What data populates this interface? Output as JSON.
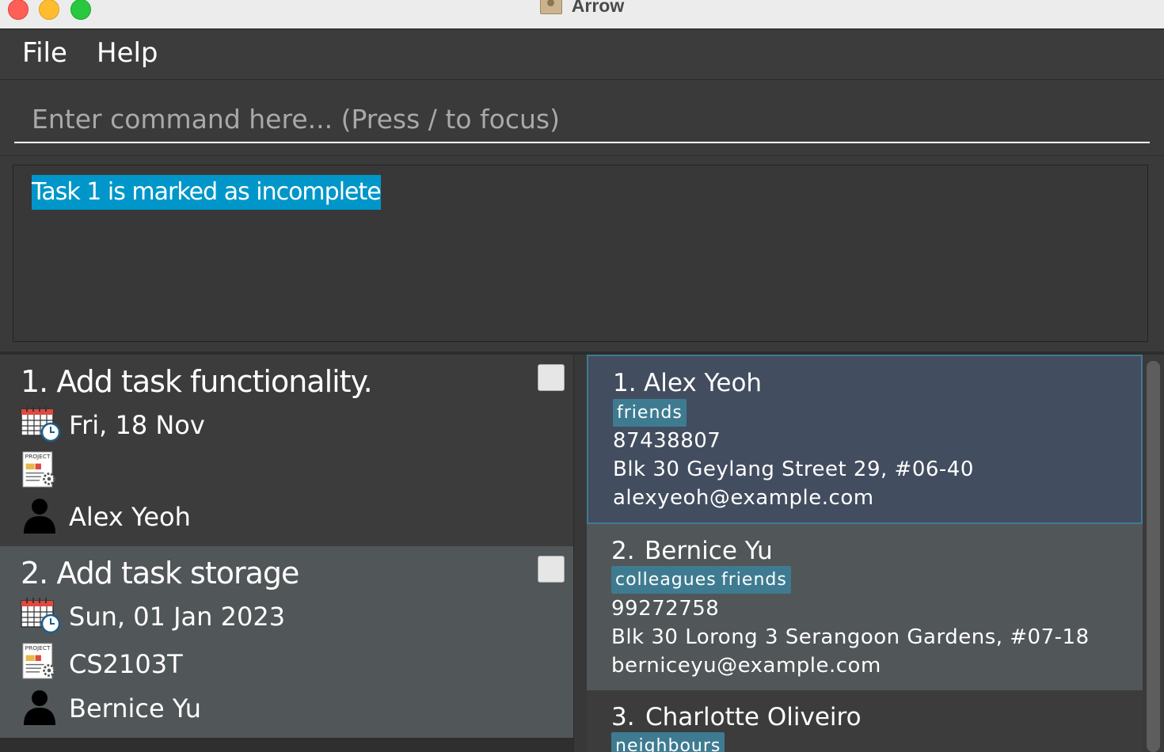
{
  "window": {
    "title": "Arrow"
  },
  "menu": {
    "file": "File",
    "help": "Help"
  },
  "command": {
    "placeholder": "Enter command here... (Press / to focus)"
  },
  "result": {
    "text": "Task 1 is marked as incomplete"
  },
  "tasks": [
    {
      "title": "1. Add task functionality.",
      "date": "Fri, 18 Nov",
      "project": "",
      "assignee": "Alex Yeoh",
      "completed": false
    },
    {
      "title": "2. Add task storage",
      "date": "Sun, 01 Jan 2023",
      "project": "CS2103T",
      "assignee": "Bernice Yu",
      "completed": false
    }
  ],
  "persons": [
    {
      "index": "1.",
      "name": "Alex Yeoh",
      "tags": [
        "friends"
      ],
      "phone": "87438807",
      "address": "Blk 30 Geylang Street 29, #06-40",
      "email": "alexyeoh@example.com"
    },
    {
      "index": "2.",
      "name": "Bernice Yu",
      "tags": [
        "colleagues",
        "friends"
      ],
      "phone": "99272758",
      "address": "Blk 30 Lorong 3 Serangoon Gardens, #07-18",
      "email": "berniceyu@example.com"
    },
    {
      "index": "3.",
      "name": "Charlotte Oliveiro",
      "tags": [
        "neighbours"
      ]
    }
  ],
  "colors": {
    "accent": "#0096c9",
    "tag": "#3e7b91",
    "selected_border": "#3e7b91"
  },
  "icons": {
    "date": "calendar-clock-icon",
    "project": "project-document-icon",
    "assignee": "person-icon",
    "status": "checkbox"
  }
}
